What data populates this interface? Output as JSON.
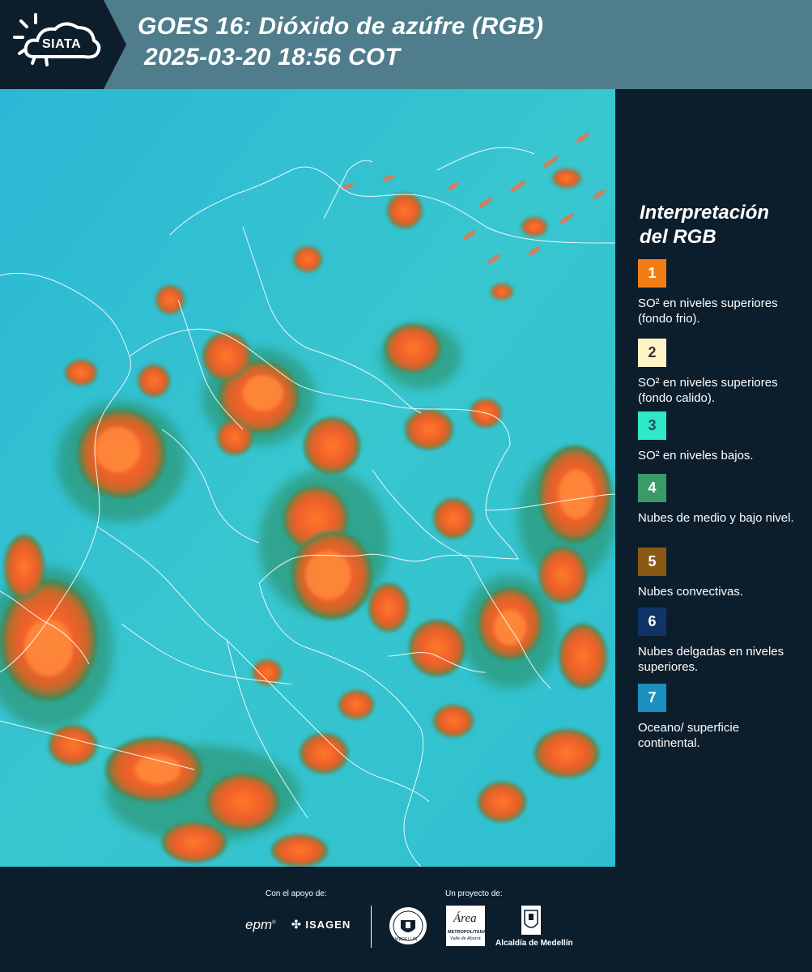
{
  "header": {
    "logo_text": "SIATA",
    "title_line1": "GOES 16: Dióxido de azúfre (RGB)",
    "title_line2": "2025-03-20 18:56 COT"
  },
  "legend": {
    "title_line1": "Interpretación",
    "title_line2": "del RGB",
    "items": [
      {
        "num": "1",
        "color": "#f47c14",
        "text_color": "#ffffff",
        "desc": "SO² en niveles superiores (fondo frio)."
      },
      {
        "num": "2",
        "color": "#fdf5c4",
        "text_color": "#333333",
        "desc": "SO² en niveles superiores (fondo calido)."
      },
      {
        "num": "3",
        "color": "#2ee8c8",
        "text_color": "#2a4a55",
        "desc": "SO² en niveles bajos."
      },
      {
        "num": "4",
        "color": "#3a9a68",
        "text_color": "#ffffff",
        "desc": "Nubes de medio y bajo nivel."
      },
      {
        "num": "5",
        "color": "#8a5a14",
        "text_color": "#ffffff",
        "desc": "Nubes convectivas."
      },
      {
        "num": "6",
        "color": "#0f3566",
        "text_color": "#ffffff",
        "desc": "Nubes delgadas en niveles superiores."
      },
      {
        "num": "7",
        "color": "#1a8fc0",
        "text_color": "#ffffff",
        "desc": "Oceano/ superficie continental."
      }
    ]
  },
  "footer": {
    "support_label": "Con el apoyo de:",
    "project_label": "Un proyecto de:",
    "epm": "epm",
    "isagen": "ISAGEN",
    "area_name": "Área",
    "area_sub1": "METROPOLITANA",
    "area_sub2": "Valle de Aburrá",
    "alcaldia": "Alcaldía de Medellín",
    "seal_text": "MEDELLÍN"
  }
}
